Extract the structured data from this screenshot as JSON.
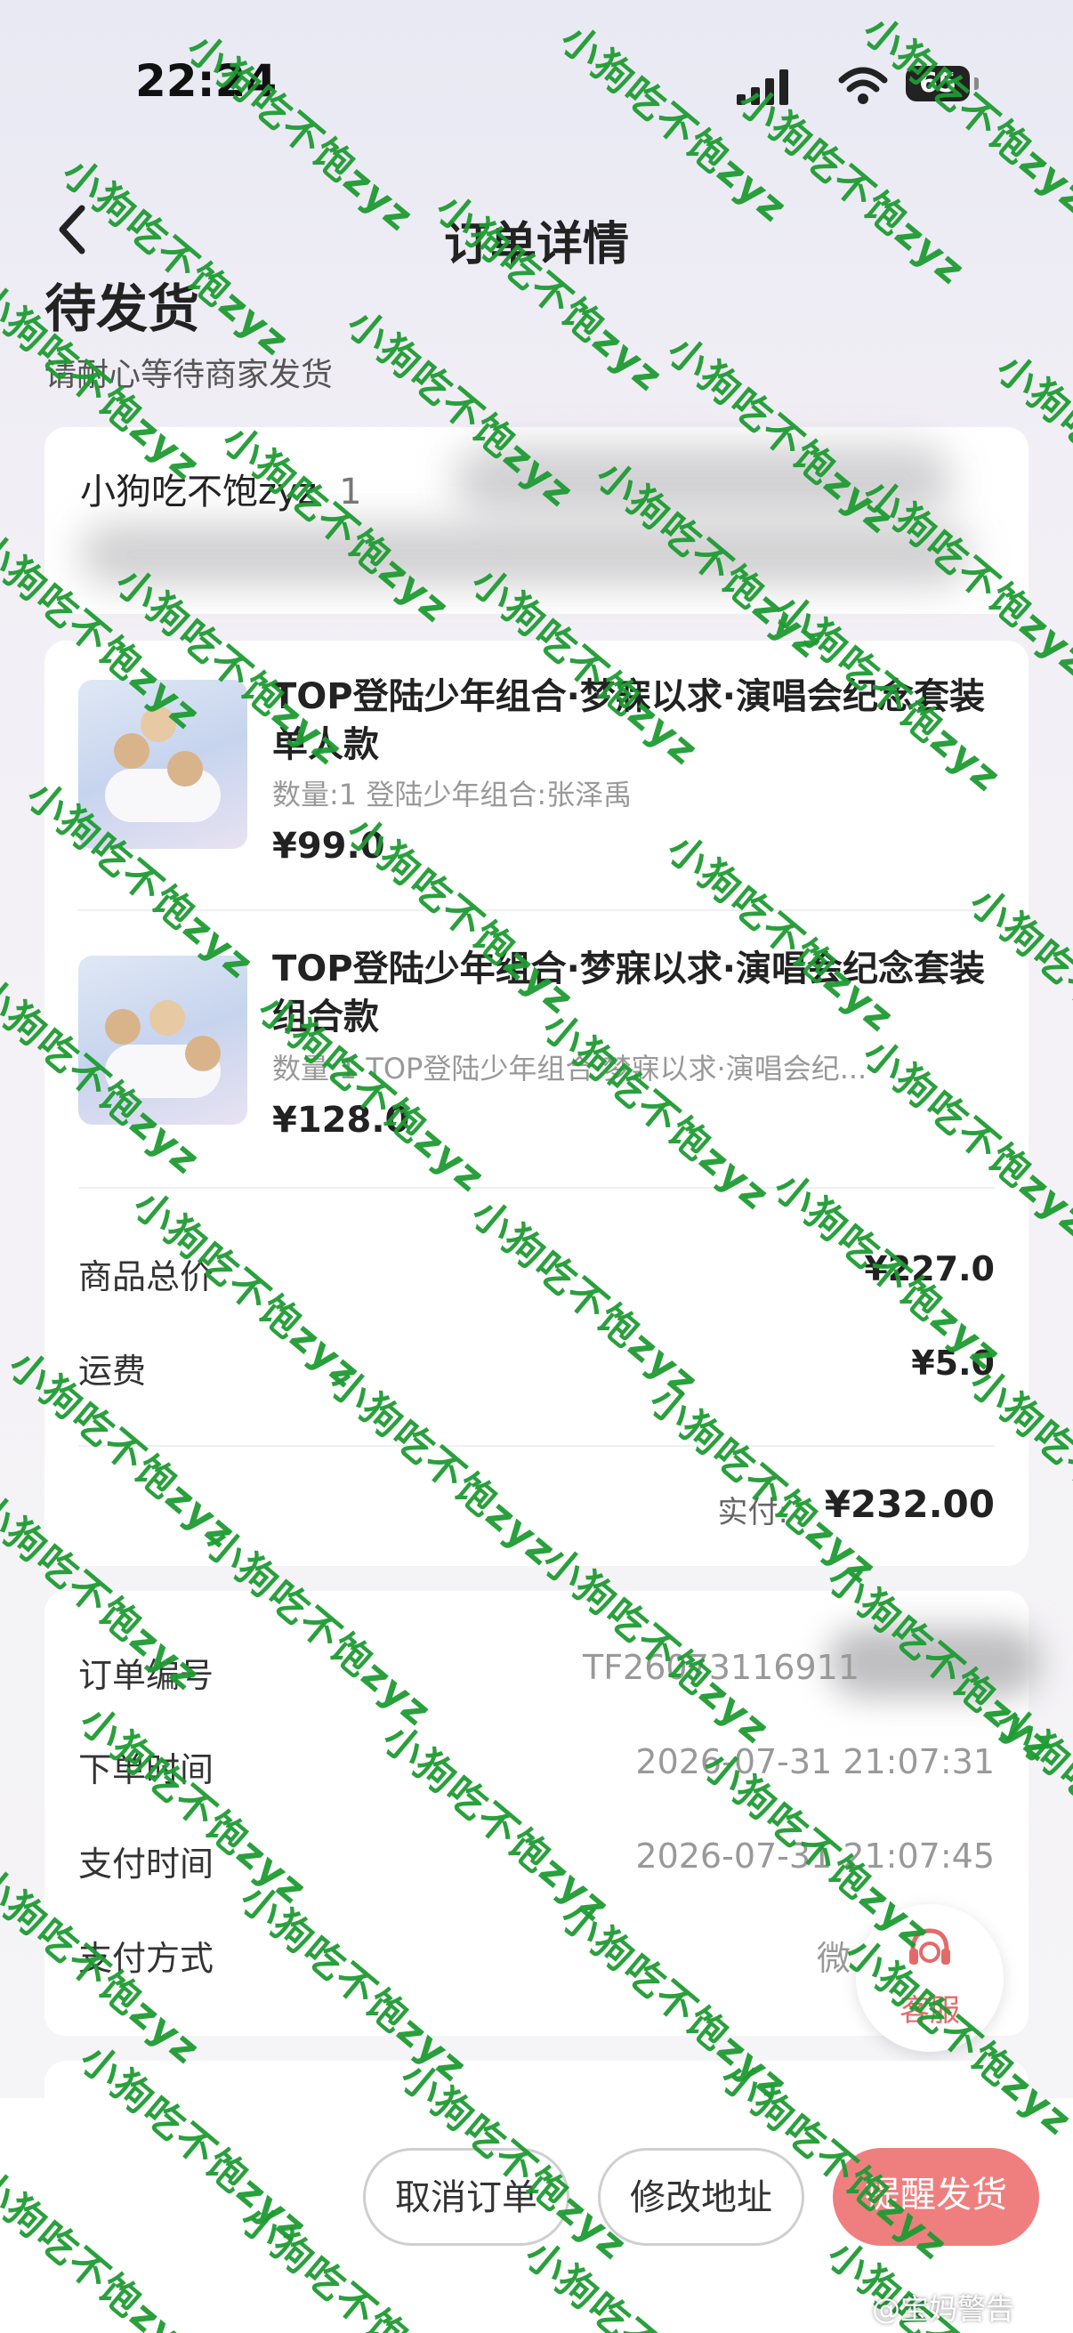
{
  "status_bar": {
    "time": "22:24",
    "battery": "65"
  },
  "header": {
    "title": "订单详情"
  },
  "order_status": {
    "title": "待发货",
    "subtitle": "请耐心等待商家发货"
  },
  "address": {
    "name": "小狗吃不饱zyz",
    "phone_prefix": "1"
  },
  "goods": [
    {
      "title": "TOP登陆少年组合·梦寐以求·演唱会纪念套装单人款",
      "spec": "数量:1 登陆少年组合:张泽禹",
      "price": "¥99.0"
    },
    {
      "title": "TOP登陆少年组合·梦寐以求·演唱会纪念套装组合款",
      "spec": "数量:1 TOP登陆少年组合·梦寐以求·演唱会纪...",
      "price": "¥128.0"
    }
  ],
  "summary": {
    "subtotal_label": "商品总价",
    "subtotal_value": "¥227.0",
    "shipping_label": "运费",
    "shipping_value": "¥5.0",
    "paid_label": "实付:",
    "paid_value": "¥232.00"
  },
  "order_info": {
    "order_no_label": "订单编号",
    "order_no_value": "TF26073116911",
    "created_label": "下单时间",
    "created_value": "2026-07-31 21:07:31",
    "paid_time_label": "支付时间",
    "paid_time_value": "2026-07-31 21:07:45",
    "pay_method_label": "支付方式",
    "pay_method_value": "微"
  },
  "customer_service": {
    "label": "客服"
  },
  "actions": {
    "cancel": "取消订单",
    "modify": "修改地址",
    "remind": "提醒发货"
  },
  "watermark": {
    "text": "小狗吃不饱zyz"
  },
  "credit": "@宝妈警告",
  "colors": {
    "accent": "#ef7f7f",
    "watermark": "#1f9b33"
  }
}
